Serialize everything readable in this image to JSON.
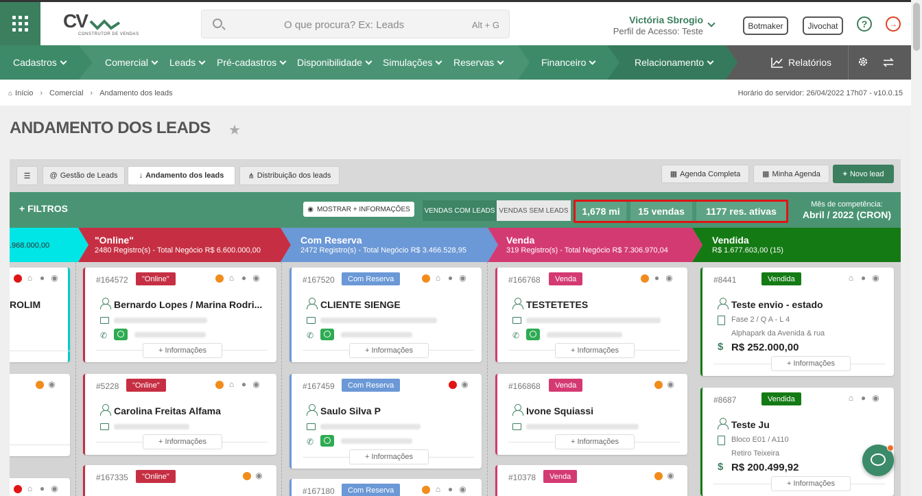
{
  "header": {
    "logo_text": "CV",
    "logo_sub": "CONSTRUTOR DE VENDAS",
    "search_placeholder": "O que procura? Ex: Leads",
    "search_shortcut": "Alt + G",
    "user_name": "Victória Sbrogio",
    "user_profile": "Perfil de Acesso: Teste",
    "botmaker": "Botmaker",
    "jivochat": "Jivochat"
  },
  "nav": {
    "items": [
      "Cadastros",
      "Comercial",
      "Leads",
      "Pré-cadastros",
      "Disponibilidade",
      "Simulações",
      "Reservas",
      "Financeiro",
      "Relacionamento"
    ],
    "reports": "Relatórios"
  },
  "breadcrumb": {
    "items": [
      "Início",
      "Comercial",
      "Andamento dos leads"
    ],
    "server": "Horário do servidor: 26/04/2022 17h07 - v10.0.15"
  },
  "page_title": "ANDAMENTO DOS LEADS",
  "tabs": {
    "gestao": "Gestão de Leads",
    "andamento": "Andamento dos leads",
    "distribuicao": "Distribuição dos leads",
    "agenda_completa": "Agenda Completa",
    "minha_agenda": "Minha Agenda",
    "novo_lead": "Novo lead"
  },
  "stats": {
    "filtros": "FILTROS",
    "mais_info": "MOSTRAR + INFORMAÇÕES",
    "vendas_com": "VENDAS COM LEADS",
    "vendas_sem": "VENDAS SEM LEADS",
    "mi": "1,678 mi",
    "vendas": "15 vendas",
    "res": "1177 res. ativas",
    "comp_label": "Mês de competência:",
    "comp_value": "Abril / 2022 (CRON)"
  },
  "columns": [
    {
      "title": "",
      "sub": ".968.000,00",
      "color": "#00e5e5"
    },
    {
      "title": "\"Online\"",
      "sub": "2480 Registro(s) - Total Negócio R$ 6.600.000,00",
      "color": "#c62f43"
    },
    {
      "title": "Com Reserva",
      "sub": "2472 Registro(s) - Total Negócio R$ 3.466.528,95",
      "color": "#6b98d6"
    },
    {
      "title": "Venda",
      "sub": "319 Registro(s) - Total Negócio R$ 7.306.970,04",
      "color": "#d43a72"
    },
    {
      "title": "Vendida",
      "sub": "R$ 1.677.603,00 (15)",
      "color": "#147a14"
    }
  ],
  "cards": {
    "c0a": {
      "name": "ROLIM"
    },
    "c1a": {
      "id": "#164572",
      "badge": "\"Online\"",
      "name": "Bernardo Lopes / Marina Rodri..."
    },
    "c1b": {
      "id": "#5228",
      "badge": "\"Online\"",
      "name": "Carolina Freitas Alfama"
    },
    "c1c": {
      "id": "#167335",
      "badge": "\"Online\""
    },
    "c2a": {
      "id": "#167520",
      "badge": "Com Reserva",
      "name": "CLIENTE SIENGE"
    },
    "c2b": {
      "id": "#167459",
      "badge": "Com Reserva",
      "name": "Saulo Silva P"
    },
    "c2c": {
      "id": "#167180",
      "badge": "Com Reserva"
    },
    "c3a": {
      "id": "#166768",
      "badge": "Venda",
      "name": "TESTETETES"
    },
    "c3b": {
      "id": "#166868",
      "badge": "Venda",
      "name": "Ivone Squiassi"
    },
    "c3c": {
      "id": "#10378",
      "badge": "Venda"
    },
    "c4a": {
      "id": "#8441",
      "badge": "Vendida",
      "name": "Teste envio - estado",
      "unit": "Fase 2 / Q A - L 4",
      "addr": "Alphapark da Avenida & rua",
      "price": "R$ 252.000,00"
    },
    "c4b": {
      "id": "#8687",
      "badge": "Vendida",
      "name": "Teste Ju",
      "unit": "Bloco E01 / A110",
      "addr": "Retiro Teixeira",
      "price": "R$ 200.499,92"
    }
  },
  "more_info": "+ Informações",
  "currency": "$"
}
